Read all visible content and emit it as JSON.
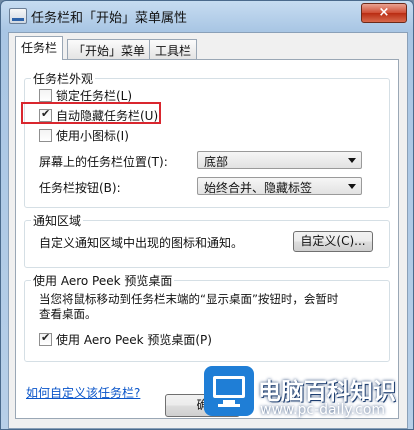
{
  "window": {
    "title": "任务栏和「开始」菜单属性",
    "close_label": "×"
  },
  "tabs": [
    {
      "label": "任务栏",
      "active": true
    },
    {
      "label": "「开始」菜单",
      "active": false
    },
    {
      "label": "工具栏",
      "active": false
    }
  ],
  "appearance": {
    "group_title": "任务栏外观",
    "lock_taskbar": {
      "label": "锁定任务栏(L)",
      "checked": false
    },
    "auto_hide": {
      "label": "自动隐藏任务栏(U)",
      "checked": true
    },
    "small_icons": {
      "label": "使用小图标(I)",
      "checked": false
    },
    "location_label": "屏幕上的任务栏位置(T):",
    "location_value": "底部",
    "buttons_label": "任务栏按钮(B):",
    "buttons_value": "始终合并、隐藏标签"
  },
  "notification": {
    "group_title": "通知区域",
    "description": "自定义通知区域中出现的图标和通知。",
    "customize_label": "自定义(C)..."
  },
  "aero_peek": {
    "group_title": "使用 Aero Peek 预览桌面",
    "description_line1": "当您将鼠标移动到任务栏末端的“显示桌面”按钮时，会暂时",
    "description_line2": "查看桌面。",
    "checkbox_label": "使用 Aero Peek 预览桌面(P)",
    "checked": true
  },
  "help_link": "如何自定义该任务栏?",
  "footer": {
    "ok_label": "确"
  },
  "watermark": {
    "title": "电脑百科知识",
    "url": "www.pc-daily.com"
  }
}
